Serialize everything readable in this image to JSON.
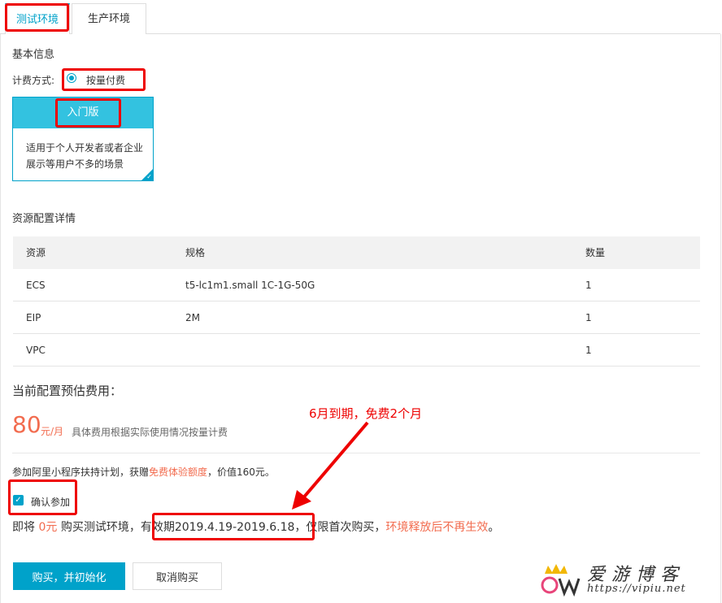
{
  "tabs": [
    {
      "label": "测试环境",
      "active": true
    },
    {
      "label": "生产环境",
      "active": false
    }
  ],
  "basic_info": {
    "title": "基本信息",
    "billing_label": "计费方式:",
    "billing_option": "按量付费"
  },
  "plan_card": {
    "title": "入门版",
    "desc_line1": "适用于个人开发者或者企业",
    "desc_line2": "展示等用户不多的场景"
  },
  "resources": {
    "title": "资源配置详情",
    "headers": [
      "资源",
      "规格",
      "数量"
    ],
    "rows": [
      [
        "ECS",
        "t5-lc1m1.small 1C-1G-50G",
        "1"
      ],
      [
        "EIP",
        "2M",
        "1"
      ],
      [
        "VPC",
        "",
        "1"
      ]
    ]
  },
  "price": {
    "title": "当前配置预估费用：",
    "amount": "80",
    "unit": "元/月",
    "note": "具体费用根据实际使用情况按量计费"
  },
  "program": {
    "text_prefix": "参加阿里小程序扶持计划，获赠",
    "highlight": "免费体验额度",
    "text_suffix": "，价值160元。",
    "confirm_label": "确认参加"
  },
  "buy_line": {
    "prefix": "即将",
    "price": "0元",
    "middle": "购买测试环境，",
    "validity": "有效期2019.4.19-2019.6.18",
    "after": "，仅限首次购买，",
    "warning": "环境释放后不再生效",
    "end": "。"
  },
  "buttons": {
    "buy": "购买，并初始化",
    "cancel": "取消购买"
  },
  "annotation": {
    "text": "6月到期，免费2个月"
  },
  "watermark": {
    "title": "爱游博客",
    "url": "https://vipiu.net"
  },
  "colors": {
    "accent": "#00a2ca",
    "price": "#f26c4f",
    "annotation": "#e00000"
  }
}
